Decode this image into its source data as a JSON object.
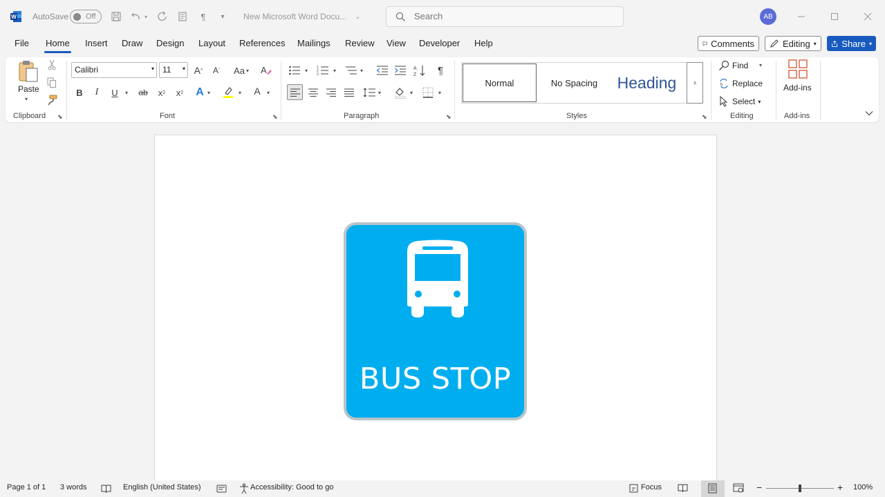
{
  "titlebar": {
    "autosave_label": "AutoSave",
    "autosave_state": "Off",
    "doc_title": "New Microsoft Word Docu...",
    "search_placeholder": "Search",
    "avatar_initials": "AB"
  },
  "tabs": [
    "File",
    "Home",
    "Insert",
    "Draw",
    "Design",
    "Layout",
    "References",
    "Mailings",
    "Review",
    "View",
    "Developer",
    "Help"
  ],
  "active_tab": "Home",
  "top_buttons": {
    "comments": "Comments",
    "editing": "Editing",
    "share": "Share"
  },
  "ribbon": {
    "clipboard": {
      "label": "Clipboard",
      "paste": "Paste"
    },
    "font": {
      "label": "Font",
      "font_name": "Calibri",
      "font_size": "11",
      "bold": "B",
      "italic": "I",
      "underline": "U",
      "strike": "ab",
      "sub": "x",
      "sup": "x",
      "change_case": "Aa",
      "grow": "A",
      "shrink": "A",
      "font_color": "A",
      "text_effects": "A"
    },
    "paragraph": {
      "label": "Paragraph",
      "pilcrow": "¶"
    },
    "styles": {
      "label": "Styles",
      "items": [
        "Normal",
        "No Spacing",
        "Heading"
      ]
    },
    "editing": {
      "label": "Editing",
      "find": "Find",
      "replace": "Replace",
      "select": "Select"
    },
    "addins": {
      "label": "Add-ins",
      "button": "Add-ins"
    }
  },
  "document": {
    "sign_text": "BUS STOP",
    "sign_color": "#00aeef",
    "sign_icon": "bus-icon"
  },
  "statusbar": {
    "page": "Page 1 of 1",
    "words": "3 words",
    "language": "English (United States)",
    "accessibility": "Accessibility: Good to go",
    "focus": "Focus",
    "zoom": "100%",
    "zoom_value": 100
  },
  "colors": {
    "accent": "#185abd",
    "avatar": "#5b6bd6"
  }
}
